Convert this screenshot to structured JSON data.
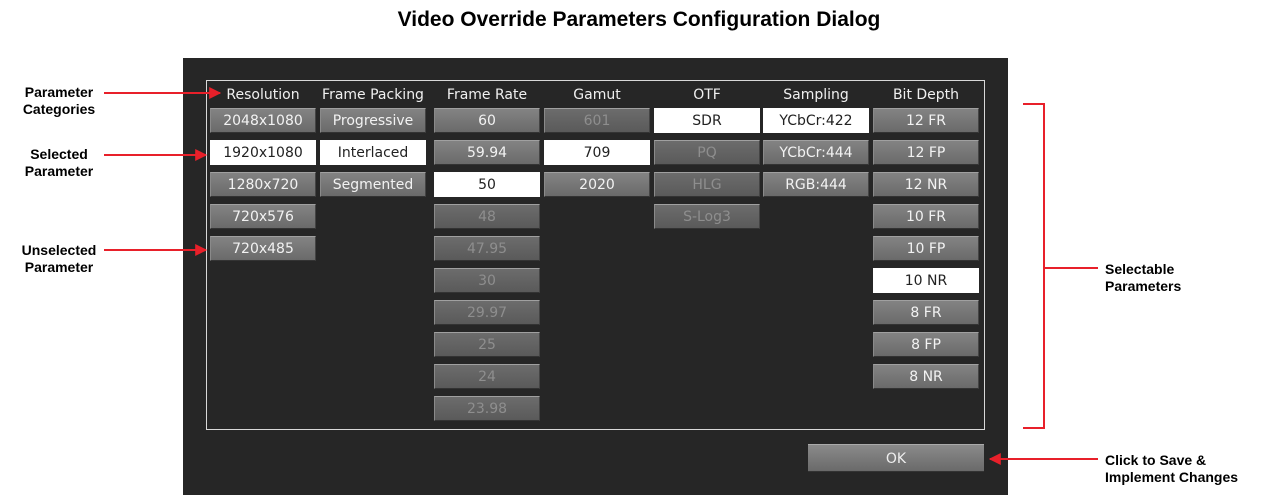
{
  "title": "Video Override Parameters Configuration Dialog",
  "columns": [
    {
      "header": "Resolution",
      "options": [
        {
          "label": "2048x1080",
          "state": "enabled"
        },
        {
          "label": "1920x1080",
          "state": "selected"
        },
        {
          "label": "1280x720",
          "state": "enabled"
        },
        {
          "label": "720x576",
          "state": "enabled"
        },
        {
          "label": "720x485",
          "state": "enabled"
        }
      ]
    },
    {
      "header": "Frame Packing",
      "options": [
        {
          "label": "Progressive",
          "state": "enabled"
        },
        {
          "label": "Interlaced",
          "state": "selected"
        },
        {
          "label": "Segmented",
          "state": "enabled"
        }
      ]
    },
    {
      "header": "Frame Rate",
      "options": [
        {
          "label": "60",
          "state": "enabled"
        },
        {
          "label": "59.94",
          "state": "enabled"
        },
        {
          "label": "50",
          "state": "selected"
        },
        {
          "label": "48",
          "state": "disabled"
        },
        {
          "label": "47.95",
          "state": "disabled"
        },
        {
          "label": "30",
          "state": "disabled"
        },
        {
          "label": "29.97",
          "state": "disabled"
        },
        {
          "label": "25",
          "state": "disabled"
        },
        {
          "label": "24",
          "state": "disabled"
        },
        {
          "label": "23.98",
          "state": "disabled"
        }
      ]
    },
    {
      "header": "Gamut",
      "options": [
        {
          "label": "601",
          "state": "disabled"
        },
        {
          "label": "709",
          "state": "selected"
        },
        {
          "label": "2020",
          "state": "enabled"
        }
      ]
    },
    {
      "header": "OTF",
      "options": [
        {
          "label": "SDR",
          "state": "selected"
        },
        {
          "label": "PQ",
          "state": "disabled"
        },
        {
          "label": "HLG",
          "state": "disabled"
        },
        {
          "label": "S-Log3",
          "state": "disabled"
        }
      ]
    },
    {
      "header": "Sampling",
      "options": [
        {
          "label": "YCbCr:422",
          "state": "selected"
        },
        {
          "label": "YCbCr:444",
          "state": "enabled"
        },
        {
          "label": "RGB:444",
          "state": "enabled"
        }
      ]
    },
    {
      "header": "Bit Depth",
      "options": [
        {
          "label": "12 FR",
          "state": "enabled"
        },
        {
          "label": "12 FP",
          "state": "enabled"
        },
        {
          "label": "12 NR",
          "state": "enabled"
        },
        {
          "label": "10 FR",
          "state": "enabled"
        },
        {
          "label": "10 FP",
          "state": "enabled"
        },
        {
          "label": "10 NR",
          "state": "selected"
        },
        {
          "label": "8 FR",
          "state": "enabled"
        },
        {
          "label": "8 FP",
          "state": "enabled"
        },
        {
          "label": "8 NR",
          "state": "enabled"
        }
      ]
    }
  ],
  "ok_label": "OK",
  "annotations": {
    "parameter_categories": [
      "Parameter",
      "Categories"
    ],
    "selected_parameter": [
      "Selected",
      "Parameter"
    ],
    "unselected_parameter": [
      "Unselected",
      "Parameter"
    ],
    "selectable_parameters": [
      "Selectable",
      "Parameters"
    ],
    "click_to_save": [
      "Click to Save &",
      "Implement Changes"
    ]
  },
  "colors": {
    "dialog_bg": "#262626",
    "annotation_arrow": "#e8202a",
    "selected_bg": "#ffffff"
  }
}
